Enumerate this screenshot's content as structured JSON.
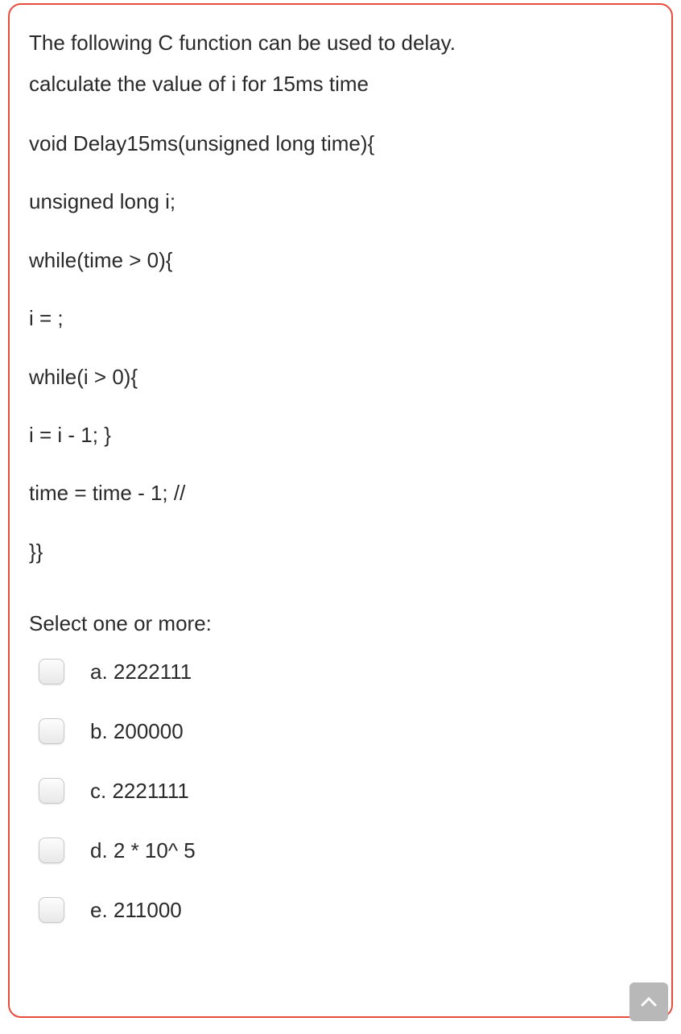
{
  "question": {
    "line1": "The following C function can be used to delay.",
    "line2": "calculate the value of i for 15ms time"
  },
  "code": {
    "l1": "void Delay15ms(unsigned long time){",
    "l2": "unsigned long i;",
    "l3": "while(time > 0){",
    "l4": "i =  ;",
    "l5": " while(i > 0){",
    "l6": "i = i - 1; }",
    "l7": "time = time - 1; //",
    "l8": "}}"
  },
  "prompt": "Select one or more:",
  "options": {
    "a": "a. 2222111",
    "b": "b. 200000",
    "c": "c. 2221111",
    "d": "d. 2 * 10^ 5",
    "e": "e. 211000"
  }
}
